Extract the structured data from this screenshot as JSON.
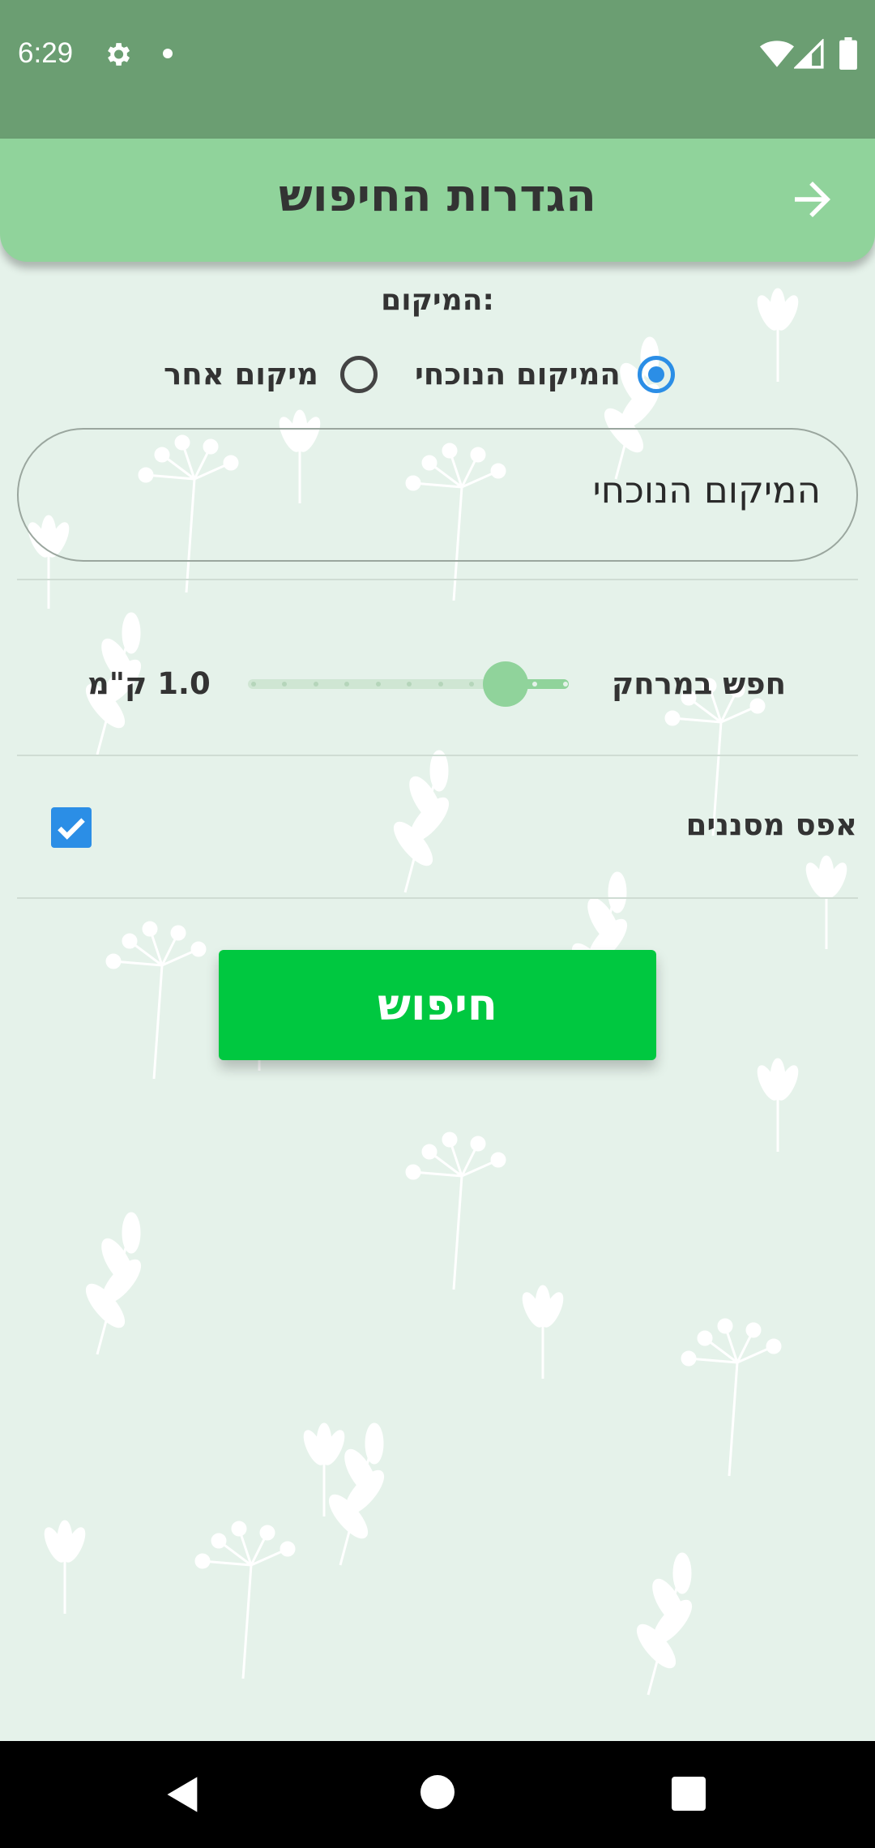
{
  "status_bar": {
    "time": "6:29",
    "icons": [
      "gear-icon",
      "dot-icon",
      "wifi-icon",
      "signal-icon",
      "battery-icon"
    ]
  },
  "header": {
    "title": "הגדרות החיפוש",
    "back_icon": "arrow-right-icon"
  },
  "location": {
    "section_label": "המיקום:",
    "options": [
      {
        "label": "המיקום הנוכחי",
        "selected": true
      },
      {
        "label": "מיקום אחר",
        "selected": false
      }
    ],
    "input_value": "המיקום הנוכחי"
  },
  "distance": {
    "label": "חפש במרחק",
    "value_text": "1.0 ק\"מ",
    "slider_fraction": 0.8
  },
  "filters": {
    "reset_label": "אפס מסננים",
    "reset_checked": true
  },
  "search_button": {
    "label": "חיפוש"
  },
  "colors": {
    "status_bar": "#6b9e72",
    "header": "#90d39b",
    "background": "#e5f2ea",
    "accent_blue": "#2b8ee6",
    "button_green": "#00c840"
  },
  "nav_bar": {
    "icons": [
      "back-triangle-icon",
      "home-circle-icon",
      "recent-square-icon"
    ]
  }
}
